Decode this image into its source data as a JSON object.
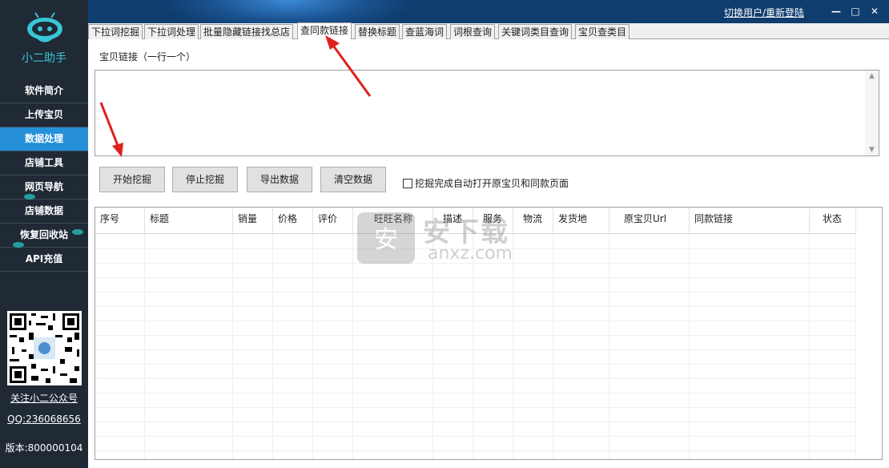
{
  "app": {
    "name": "小二助手",
    "switch_user": "切换用户/重新登陆",
    "follow_link": "关注小二公众号",
    "qq": "QQ:236068656",
    "version": "版本:800000104"
  },
  "window_controls": {
    "minimize": "—",
    "maximize": "□",
    "close": "✕"
  },
  "sidebar": {
    "items": [
      {
        "label": "软件简介",
        "active": false
      },
      {
        "label": "上传宝贝",
        "active": false
      },
      {
        "label": "数据处理",
        "active": true
      },
      {
        "label": "店铺工具",
        "active": false
      },
      {
        "label": "网页导航",
        "active": false
      },
      {
        "label": "店铺数据",
        "active": false
      },
      {
        "label": "恢复回收站",
        "active": false
      },
      {
        "label": "API充值",
        "active": false
      }
    ]
  },
  "tabs": [
    {
      "label": "下拉词挖掘"
    },
    {
      "label": "下拉词处理"
    },
    {
      "label": "批量隐藏链接找总店"
    },
    {
      "label": "查同款链接",
      "active": true
    },
    {
      "label": "替换标题"
    },
    {
      "label": "查蓝海词"
    },
    {
      "label": "词根查询"
    },
    {
      "label": "关键词类目查询"
    },
    {
      "label": "宝贝查类目"
    }
  ],
  "form": {
    "link_label": "宝贝链接（一行一个）",
    "link_value": "",
    "start_button": "开始挖掘",
    "stop_button": "停止挖掘",
    "export_button": "导出数据",
    "clear_button": "清空数据",
    "auto_open_label": "挖掘完成自动打开原宝贝和同款页面",
    "auto_open_checked": false
  },
  "grid": {
    "columns": [
      "序号",
      "标题",
      "销量",
      "价格",
      "评价",
      "旺旺名称",
      "描述",
      "服务",
      "物流",
      "发货地",
      "原宝贝Url",
      "同款链接",
      "状态"
    ],
    "rows": []
  },
  "watermark": {
    "cn": "安下载",
    "en": "anxz.com",
    "shield_char": "安"
  },
  "colors": {
    "sidebar_bg": "#1f2a35",
    "sidebar_active": "#2590d8",
    "banner_bg": "#0f3d6e",
    "accent_teal": "#39c6d8",
    "annotation_red": "#e0201c"
  }
}
